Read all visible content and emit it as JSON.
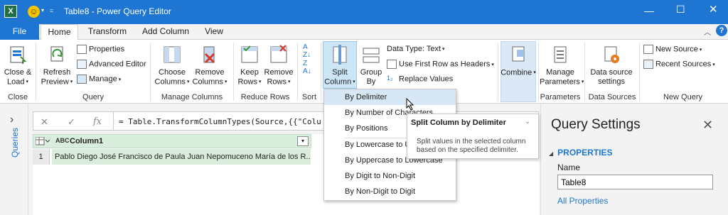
{
  "titlebar": {
    "title": "Table8 - Power Query Editor",
    "app_logo": "X",
    "smiley": "☺",
    "qat_arrow": "▾",
    "qat_eq": "="
  },
  "tabs": {
    "file": "File",
    "home": "Home",
    "transform": "Transform",
    "add_column": "Add Column",
    "view": "View",
    "help": "?"
  },
  "ribbon": {
    "close_load": [
      "Close &",
      "Load"
    ],
    "refresh_preview": [
      "Refresh",
      "Preview"
    ],
    "properties": "Properties",
    "advanced_editor": "Advanced Editor",
    "manage": "Manage",
    "choose_columns": [
      "Choose",
      "Columns"
    ],
    "remove_columns": [
      "Remove",
      "Columns"
    ],
    "keep_rows": [
      "Keep",
      "Rows"
    ],
    "remove_rows": [
      "Remove",
      "Rows"
    ],
    "split_column": [
      "Split",
      "Column"
    ],
    "group_by": [
      "Group",
      "By"
    ],
    "data_type": "Data Type: Text",
    "use_first_row": "Use First Row as Headers",
    "replace_values": "Replace Values",
    "combine": "Combine",
    "manage_parameters": [
      "Manage",
      "Parameters"
    ],
    "data_source_settings": [
      "Data source",
      "settings"
    ],
    "new_source": "New Source",
    "recent_sources": "Recent Sources",
    "groups": {
      "close": "Close",
      "query": "Query",
      "manage_columns": "Manage Columns",
      "reduce_rows": "Reduce Rows",
      "sort": "Sort",
      "parameters": "Parameters",
      "data_sources": "Data Sources",
      "new_query": "New Query"
    }
  },
  "left_nav": {
    "chevron": "›",
    "label": "Queries"
  },
  "formula": {
    "fx": "fx",
    "text": "= Table.TransformColumnTypes(Source,{{\"Colu"
  },
  "table": {
    "header_type": "ABC",
    "column": "Column1",
    "rows": [
      {
        "num": "1",
        "value": "Pablo Diego José Francisco de Paula Juan Nepomuceno María de los R..."
      }
    ]
  },
  "split_menu": {
    "items": [
      "By Delimiter",
      "By Number of Characters",
      "By Positions",
      "By Lowercase to Uppercase",
      "By Uppercase to Lowercase",
      "By Digit to Non-Digit",
      "By Non-Digit to Digit"
    ]
  },
  "tooltip": {
    "title": "Split Column by Delimiter",
    "desc": "Split values in the selected column based on the specified delimiter."
  },
  "query_settings": {
    "title": "Query Settings",
    "properties": "PROPERTIES",
    "name_label": "Name",
    "name_value": "Table8",
    "all_properties": "All Properties"
  }
}
